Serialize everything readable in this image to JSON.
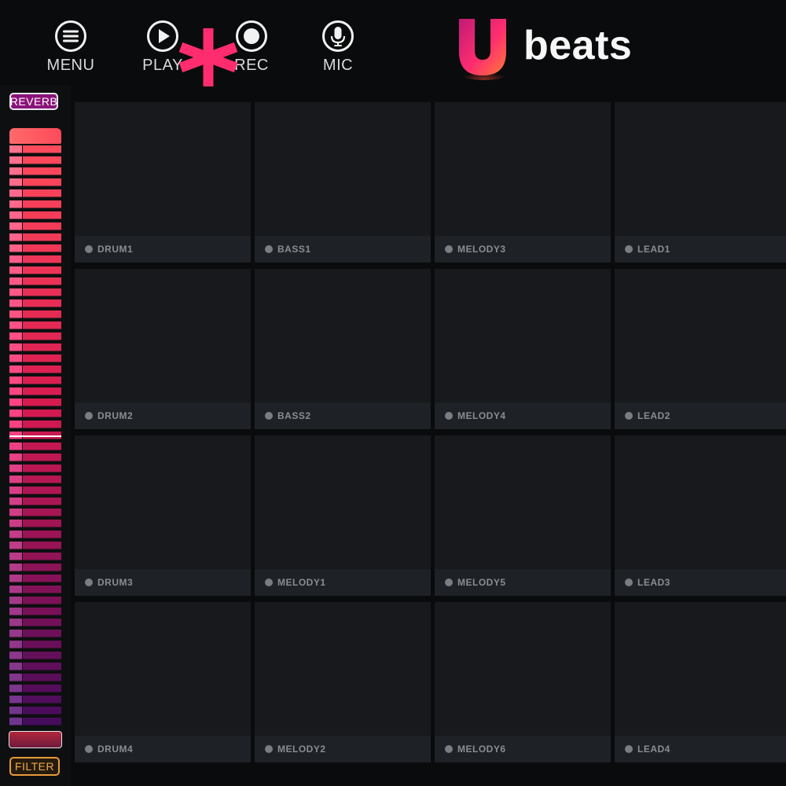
{
  "header": {
    "menu_label": "MENU",
    "play_label": "PLAY",
    "rec_label": "REC",
    "mic_label": "MIC",
    "logo_text": "beats",
    "logo_letter": "U"
  },
  "sidebar": {
    "reverb_label": "REVERB",
    "filter_label": "FILTER"
  },
  "pads": [
    {
      "label": "DRUM1"
    },
    {
      "label": "BASS1"
    },
    {
      "label": "MELODY3"
    },
    {
      "label": "LEAD1"
    },
    {
      "label": "DRUM2"
    },
    {
      "label": "BASS2"
    },
    {
      "label": "MELODY4"
    },
    {
      "label": "LEAD2"
    },
    {
      "label": "DRUM3"
    },
    {
      "label": "MELODY1"
    },
    {
      "label": "MELODY5"
    },
    {
      "label": "LEAD3"
    },
    {
      "label": "DRUM4"
    },
    {
      "label": "MELODY2"
    },
    {
      "label": "MELODY6"
    },
    {
      "label": "LEAD4"
    }
  ],
  "colors": {
    "accent": "#ff2d6f",
    "reverb": "#8a1479",
    "filter": "#e89a3a"
  },
  "icons": {
    "menu": "menu-icon",
    "play": "play-icon",
    "rec": "record-icon",
    "mic": "microphone-icon",
    "asterisk": "asterisk-icon"
  }
}
